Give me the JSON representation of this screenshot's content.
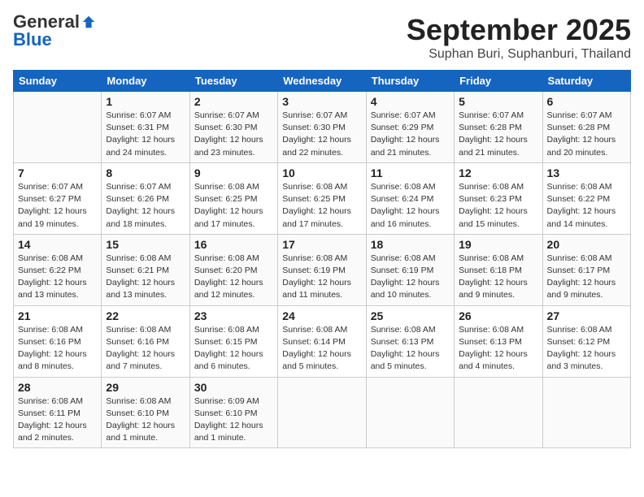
{
  "header": {
    "logo_general": "General",
    "logo_blue": "Blue",
    "month": "September 2025",
    "location": "Suphan Buri, Suphanburi, Thailand"
  },
  "days_of_week": [
    "Sunday",
    "Monday",
    "Tuesday",
    "Wednesday",
    "Thursday",
    "Friday",
    "Saturday"
  ],
  "weeks": [
    [
      {
        "day": "",
        "info": ""
      },
      {
        "day": "1",
        "info": "Sunrise: 6:07 AM\nSunset: 6:31 PM\nDaylight: 12 hours\nand 24 minutes."
      },
      {
        "day": "2",
        "info": "Sunrise: 6:07 AM\nSunset: 6:30 PM\nDaylight: 12 hours\nand 23 minutes."
      },
      {
        "day": "3",
        "info": "Sunrise: 6:07 AM\nSunset: 6:30 PM\nDaylight: 12 hours\nand 22 minutes."
      },
      {
        "day": "4",
        "info": "Sunrise: 6:07 AM\nSunset: 6:29 PM\nDaylight: 12 hours\nand 21 minutes."
      },
      {
        "day": "5",
        "info": "Sunrise: 6:07 AM\nSunset: 6:28 PM\nDaylight: 12 hours\nand 21 minutes."
      },
      {
        "day": "6",
        "info": "Sunrise: 6:07 AM\nSunset: 6:28 PM\nDaylight: 12 hours\nand 20 minutes."
      }
    ],
    [
      {
        "day": "7",
        "info": "Sunrise: 6:07 AM\nSunset: 6:27 PM\nDaylight: 12 hours\nand 19 minutes."
      },
      {
        "day": "8",
        "info": "Sunrise: 6:07 AM\nSunset: 6:26 PM\nDaylight: 12 hours\nand 18 minutes."
      },
      {
        "day": "9",
        "info": "Sunrise: 6:08 AM\nSunset: 6:25 PM\nDaylight: 12 hours\nand 17 minutes."
      },
      {
        "day": "10",
        "info": "Sunrise: 6:08 AM\nSunset: 6:25 PM\nDaylight: 12 hours\nand 17 minutes."
      },
      {
        "day": "11",
        "info": "Sunrise: 6:08 AM\nSunset: 6:24 PM\nDaylight: 12 hours\nand 16 minutes."
      },
      {
        "day": "12",
        "info": "Sunrise: 6:08 AM\nSunset: 6:23 PM\nDaylight: 12 hours\nand 15 minutes."
      },
      {
        "day": "13",
        "info": "Sunrise: 6:08 AM\nSunset: 6:22 PM\nDaylight: 12 hours\nand 14 minutes."
      }
    ],
    [
      {
        "day": "14",
        "info": "Sunrise: 6:08 AM\nSunset: 6:22 PM\nDaylight: 12 hours\nand 13 minutes."
      },
      {
        "day": "15",
        "info": "Sunrise: 6:08 AM\nSunset: 6:21 PM\nDaylight: 12 hours\nand 13 minutes."
      },
      {
        "day": "16",
        "info": "Sunrise: 6:08 AM\nSunset: 6:20 PM\nDaylight: 12 hours\nand 12 minutes."
      },
      {
        "day": "17",
        "info": "Sunrise: 6:08 AM\nSunset: 6:19 PM\nDaylight: 12 hours\nand 11 minutes."
      },
      {
        "day": "18",
        "info": "Sunrise: 6:08 AM\nSunset: 6:19 PM\nDaylight: 12 hours\nand 10 minutes."
      },
      {
        "day": "19",
        "info": "Sunrise: 6:08 AM\nSunset: 6:18 PM\nDaylight: 12 hours\nand 9 minutes."
      },
      {
        "day": "20",
        "info": "Sunrise: 6:08 AM\nSunset: 6:17 PM\nDaylight: 12 hours\nand 9 minutes."
      }
    ],
    [
      {
        "day": "21",
        "info": "Sunrise: 6:08 AM\nSunset: 6:16 PM\nDaylight: 12 hours\nand 8 minutes."
      },
      {
        "day": "22",
        "info": "Sunrise: 6:08 AM\nSunset: 6:16 PM\nDaylight: 12 hours\nand 7 minutes."
      },
      {
        "day": "23",
        "info": "Sunrise: 6:08 AM\nSunset: 6:15 PM\nDaylight: 12 hours\nand 6 minutes."
      },
      {
        "day": "24",
        "info": "Sunrise: 6:08 AM\nSunset: 6:14 PM\nDaylight: 12 hours\nand 5 minutes."
      },
      {
        "day": "25",
        "info": "Sunrise: 6:08 AM\nSunset: 6:13 PM\nDaylight: 12 hours\nand 5 minutes."
      },
      {
        "day": "26",
        "info": "Sunrise: 6:08 AM\nSunset: 6:13 PM\nDaylight: 12 hours\nand 4 minutes."
      },
      {
        "day": "27",
        "info": "Sunrise: 6:08 AM\nSunset: 6:12 PM\nDaylight: 12 hours\nand 3 minutes."
      }
    ],
    [
      {
        "day": "28",
        "info": "Sunrise: 6:08 AM\nSunset: 6:11 PM\nDaylight: 12 hours\nand 2 minutes."
      },
      {
        "day": "29",
        "info": "Sunrise: 6:08 AM\nSunset: 6:10 PM\nDaylight: 12 hours\nand 1 minute."
      },
      {
        "day": "30",
        "info": "Sunrise: 6:09 AM\nSunset: 6:10 PM\nDaylight: 12 hours\nand 1 minute."
      },
      {
        "day": "",
        "info": ""
      },
      {
        "day": "",
        "info": ""
      },
      {
        "day": "",
        "info": ""
      },
      {
        "day": "",
        "info": ""
      }
    ]
  ]
}
